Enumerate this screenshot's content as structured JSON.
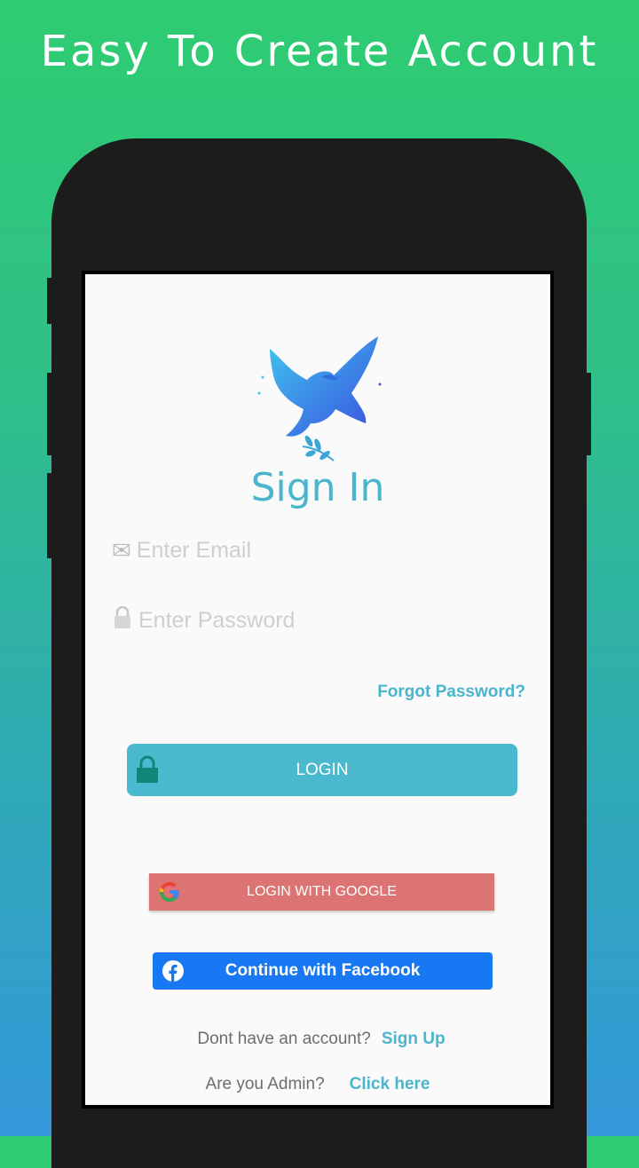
{
  "headline": "Easy To Create Account",
  "signin": {
    "title": "Sign In",
    "email_placeholder": "Enter Email",
    "password_placeholder": "Enter Password",
    "forgot_label": "Forgot Password?",
    "login_label": "LOGIN",
    "google_label": "LOGIN WITH GOOGLE",
    "facebook_label": "Continue with Facebook",
    "no_account_text": "Dont have an account?",
    "signup_label": "Sign Up",
    "admin_text": "Are you Admin?",
    "admin_link": "Click here"
  },
  "icons": {
    "email": "envelope-icon",
    "password": "lock-icon",
    "login": "lock-icon",
    "google": "google-icon",
    "facebook": "facebook-icon",
    "logo": "dove-logo"
  },
  "colors": {
    "accent": "#4ab5cc",
    "login_button": "#4ab9ce",
    "google_button": "#dd7474",
    "facebook_button": "#1877f2"
  }
}
